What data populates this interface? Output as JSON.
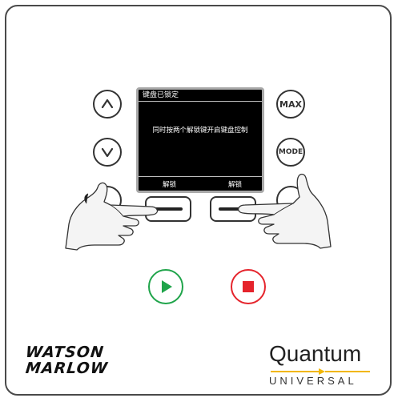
{
  "screen": {
    "title": "键盘已锁定",
    "message": "同时按两个解锁键开启键盘控制",
    "softkey_left": "解锁",
    "softkey_right": "解锁"
  },
  "buttons": {
    "max_label": "MAX",
    "mode_label": "MODE"
  },
  "brand": {
    "left_line1": "WATSON",
    "left_line2": "MARLOW",
    "right_word": "Quantum",
    "right_sub": "UNIVERSAL",
    "accent_yellow": "#f2b705"
  },
  "colors": {
    "run_green": "#1fa44a",
    "stop_red": "#e5242c"
  },
  "icons": {
    "up": "chevron-up-icon",
    "down": "chevron-down-icon",
    "play": "play-icon",
    "stop": "stop-icon"
  }
}
